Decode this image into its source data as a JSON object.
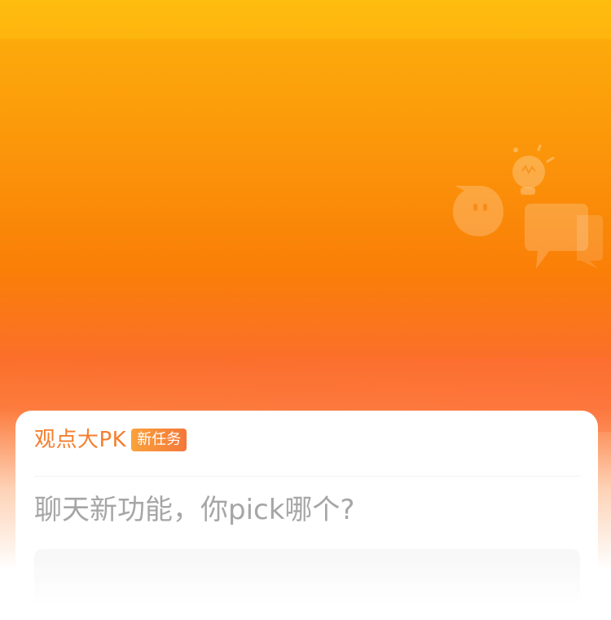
{
  "card": {
    "title": "观点大PK",
    "badge": "新任务",
    "question": "聊天新功能，你pick哪个?"
  },
  "colors": {
    "title": "#f47e2f",
    "badge_start": "#f9a23b",
    "badge_end": "#f5773a",
    "question": "#a6a6a6",
    "background_top": "#fdb60b",
    "background_mid": "#fa7f07"
  },
  "icons": {
    "hero": [
      "chat-face-icon",
      "lightbulb-icon",
      "chat-bubbles-icon"
    ]
  }
}
